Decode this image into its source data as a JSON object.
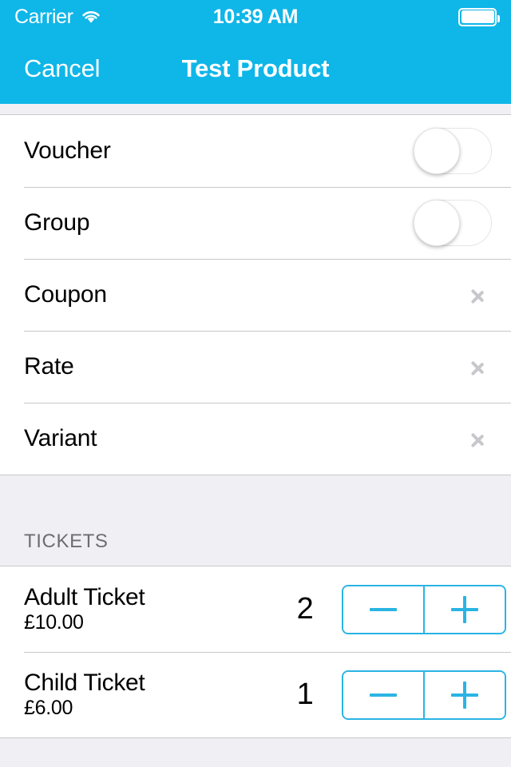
{
  "status_bar": {
    "carrier": "Carrier",
    "wifi_icon": "wifi-icon",
    "time": "10:39 AM",
    "battery_icon": "battery-full-icon"
  },
  "nav_bar": {
    "cancel_label": "Cancel",
    "title": "Test Product",
    "background_color": "#0FB6E8",
    "text_color": "#FFFFFF"
  },
  "options_section": {
    "rows": [
      {
        "label": "Voucher",
        "accessory": "switch",
        "value": "off"
      },
      {
        "label": "Group",
        "accessory": "switch",
        "value": "off"
      },
      {
        "label": "Coupon",
        "accessory": "chevron"
      },
      {
        "label": "Rate",
        "accessory": "chevron"
      },
      {
        "label": "Variant",
        "accessory": "chevron"
      }
    ]
  },
  "tickets_section": {
    "header": "TICKETS",
    "accent_color": "#2AB4E3",
    "stepper": {
      "decrement_label": "−",
      "increment_label": "+"
    },
    "rows": [
      {
        "title": "Adult Ticket",
        "price": "£10.00",
        "quantity": "2"
      },
      {
        "title": "Child Ticket",
        "price": "£6.00",
        "quantity": "1"
      }
    ]
  }
}
